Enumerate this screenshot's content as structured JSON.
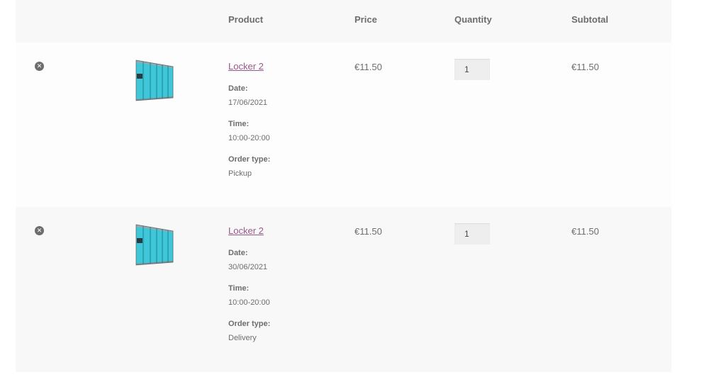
{
  "headers": {
    "product": "Product",
    "price": "Price",
    "quantity": "Quantity",
    "subtotal": "Subtotal"
  },
  "items": [
    {
      "name": "Locker 2",
      "remove_icon": "close-circle-icon",
      "date_label": "Date:",
      "date": "17/06/2021",
      "time_label": "Time:",
      "time": "10:00-20:00",
      "order_type_label": "Order type:",
      "order_type": "Pickup",
      "price": "€11.50",
      "quantity": "1",
      "subtotal": "€11.50"
    },
    {
      "name": "Locker 2",
      "remove_icon": "close-circle-icon",
      "date_label": "Date:",
      "date": "30/06/2021",
      "time_label": "Time:",
      "time": "10:00-20:00",
      "order_type_label": "Order type:",
      "order_type": "Delivery",
      "price": "€11.50",
      "quantity": "1",
      "subtotal": "€11.50"
    }
  ],
  "colors": {
    "link": "#96588a",
    "text": "#6d6d6d",
    "header_bg": "#f8f8f8",
    "input_bg": "#eeeeee"
  }
}
